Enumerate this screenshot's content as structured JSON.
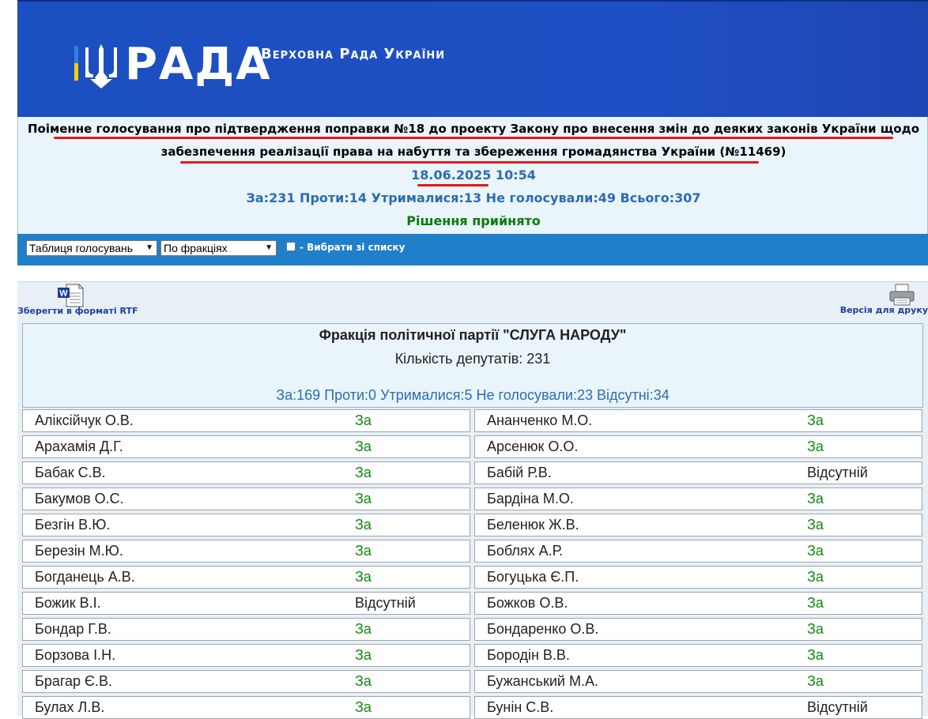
{
  "header": {
    "logo_text": "РАДА",
    "subtitle": "Верховна Рада України"
  },
  "vote": {
    "title_line1": "Поіменне голосування про підтвердження поправки №18 до проекту Закону про внесення змін до деяких законів України щодо",
    "title_line2": "забезпечення реалізації права на набуття та збереження громадянства України (№11469)",
    "datetime": "18.06.2025 10:54",
    "totals": "За:231 Проти:14 Утрималися:13 Не голосували:49 Всього:307",
    "decision": "Рішення прийнято"
  },
  "toolbar": {
    "view_select": "Таблиця голосувань",
    "group_select": "По фракціях",
    "checkbox_label": "- Вибрати зі списку"
  },
  "actions": {
    "rtf_label": "Зберегти в форматі RTF",
    "print_label": "Версія для друку"
  },
  "faction": {
    "name": "Фракція політичної партії \"СЛУГА НАРОДУ\"",
    "count": "Кількість депутатів: 231",
    "stats": "За:169 Проти:0 Утрималися:5 Не голосували:23 Відсутні:34"
  },
  "deputies_left": [
    {
      "name": "Аліксійчук О.В.",
      "vote": "За"
    },
    {
      "name": "Арахамія Д.Г.",
      "vote": "За"
    },
    {
      "name": "Бабак С.В.",
      "vote": "За"
    },
    {
      "name": "Бакумов О.С.",
      "vote": "За"
    },
    {
      "name": "Безгін В.Ю.",
      "vote": "За"
    },
    {
      "name": "Березін М.Ю.",
      "vote": "За"
    },
    {
      "name": "Богданець А.В.",
      "vote": "За"
    },
    {
      "name": "Божик В.І.",
      "vote": "Відсутній"
    },
    {
      "name": "Бондар Г.В.",
      "vote": "За"
    },
    {
      "name": "Борзова І.Н.",
      "vote": "За"
    },
    {
      "name": "Брагар Є.В.",
      "vote": "За"
    },
    {
      "name": "Булах Л.В.",
      "vote": "За"
    }
  ],
  "deputies_right": [
    {
      "name": "Ананченко М.О.",
      "vote": "За"
    },
    {
      "name": "Арсенюк О.О.",
      "vote": "За"
    },
    {
      "name": "Бабій Р.В.",
      "vote": "Відсутній"
    },
    {
      "name": "Бардіна М.О.",
      "vote": "За"
    },
    {
      "name": "Беленюк Ж.В.",
      "vote": "За"
    },
    {
      "name": "Боблях А.Р.",
      "vote": "За"
    },
    {
      "name": "Богуцька Є.П.",
      "vote": "За"
    },
    {
      "name": "Божков О.В.",
      "vote": "За"
    },
    {
      "name": "Бондаренко О.В.",
      "vote": "За"
    },
    {
      "name": "Бородін В.В.",
      "vote": "За"
    },
    {
      "name": "Бужанський М.А.",
      "vote": "За"
    },
    {
      "name": "Бунін С.В.",
      "vote": "Відсутній"
    }
  ],
  "colors": {
    "banner": "#1c4fc0",
    "toolbar": "#1f7fc9",
    "vote_yes": "#0e8a0e",
    "stats_blue": "#2b6cb3",
    "decision_green": "#0b7a0b",
    "underline_red": "#e01a1a"
  }
}
